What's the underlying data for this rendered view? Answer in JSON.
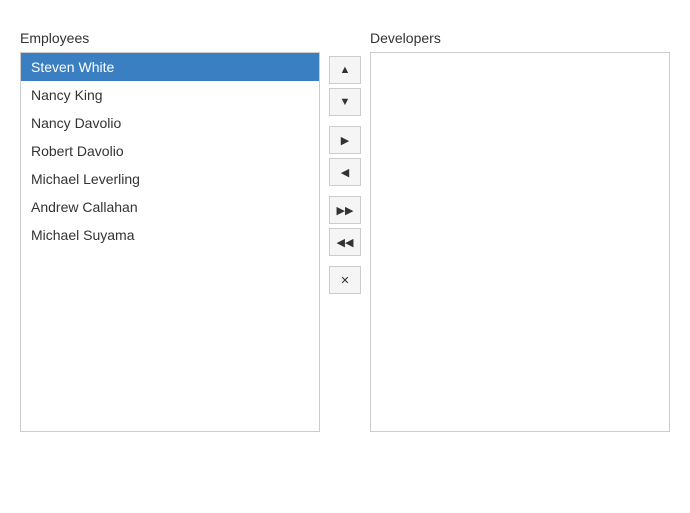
{
  "employees": {
    "label": "Employees",
    "items": [
      {
        "id": 0,
        "name": "Steven White",
        "selected": true
      },
      {
        "id": 1,
        "name": "Nancy King",
        "selected": false
      },
      {
        "id": 2,
        "name": "Nancy Davolio",
        "selected": false
      },
      {
        "id": 3,
        "name": "Robert Davolio",
        "selected": false
      },
      {
        "id": 4,
        "name": "Michael Leverling",
        "selected": false
      },
      {
        "id": 5,
        "name": "Andrew Callahan",
        "selected": false
      },
      {
        "id": 6,
        "name": "Michael Suyama",
        "selected": false
      }
    ]
  },
  "developers": {
    "label": "Developers",
    "items": []
  },
  "controls": {
    "move_up": "▲",
    "move_down": "▼",
    "move_right": "▶",
    "move_left": "◀",
    "move_all_right": "▶▶",
    "move_all_left": "◀◀",
    "remove": "✕"
  }
}
